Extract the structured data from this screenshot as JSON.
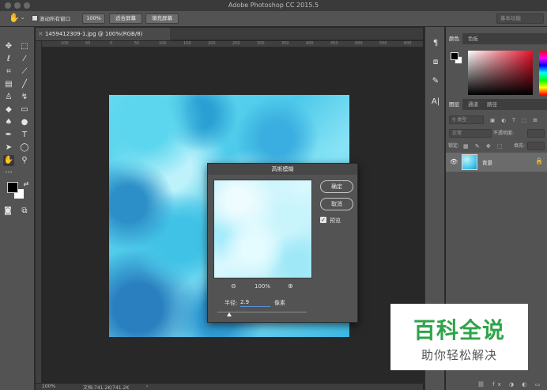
{
  "window": {
    "title": "Adobe Photoshop CC 2015.5"
  },
  "options_bar": {
    "scroll_all_label": "滚动所有窗口",
    "zoom_100": "100%",
    "fit_screen": "适合屏幕",
    "fill_screen": "填充屏幕",
    "workspace": "基本功能"
  },
  "document": {
    "tab_title": "1459412309-1.jpg @ 100%(RGB/8)",
    "zoom": "100%",
    "doc_size": "文档:741.2K/741.2K",
    "ruler_ticks": [
      "100",
      "50",
      "0",
      "50",
      "100",
      "150",
      "200",
      "250",
      "300",
      "350",
      "400",
      "450",
      "500",
      "550",
      "600",
      "650"
    ]
  },
  "panels": {
    "color_tabs": [
      "颜色",
      "色板"
    ],
    "layer_tabs": [
      "图层",
      "通道",
      "路径"
    ],
    "kind_filter": "类型",
    "blend_mode": "正常",
    "opacity_label": "不透明度:",
    "lock_label": "锁定:",
    "fill_label": "填充:",
    "layer_name": "背景"
  },
  "dialog": {
    "title": "高斯模糊",
    "ok": "确定",
    "cancel": "取消",
    "preview_label": "预览",
    "zoom": "100%",
    "radius_label": "半径:",
    "radius_value": "2.9",
    "unit": "像素",
    "radius_slider_fraction": 0.13
  },
  "watermark": {
    "title": "百科全说",
    "subtitle": "助你轻松解决"
  },
  "colors": {
    "accent_blue": "#5b8fd8",
    "watermark_green": "#2fa44a"
  }
}
